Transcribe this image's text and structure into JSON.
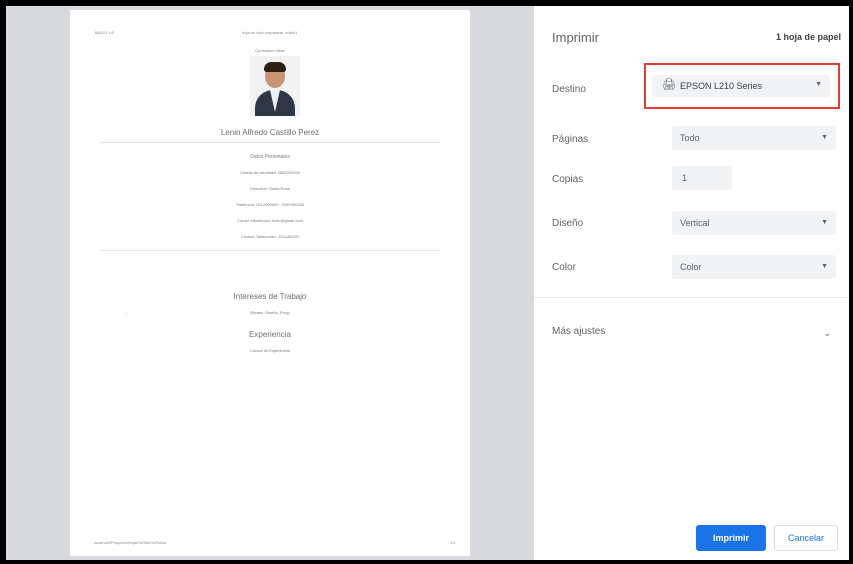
{
  "preview": {
    "header_left": "18/6/21 4:0",
    "header_center": "hoja de vida preparada. ndbm1",
    "curriculum_title": "Curriculum Vitae",
    "name": "Lenin Alfredo Castillo Perez",
    "section_personal": "Datos Personales",
    "personal_lines": [
      "Cédula de identidad: 0850002000",
      "Dirección: Santa Rosa",
      "Teléfono/s: 0212000000 - 0987000000",
      "Correo electrónico: lenin@gmail.com",
      "Ciudad: Tabacundo - ECUADOR"
    ],
    "section_interests": "Intereses de Trabajo",
    "interests_line": "(Redes, Diseño, Prog)",
    "section_experience": "Experiencia",
    "experience_line": "Cursos de Experiencia",
    "footer_left": "localhost/Proyecto/Hojas%20de%20vida",
    "footer_right": "1/1",
    "bullet": "."
  },
  "panel": {
    "title": "Imprimir",
    "sheet_count": "1 hoja de papel",
    "destination_label": "Destino",
    "destination_value": "EPSON L210 Series",
    "pages_label": "Páginas",
    "pages_value": "Todo",
    "copies_label": "Copias",
    "copies_value": "1",
    "layout_label": "Diseño",
    "layout_value": "Vertical",
    "color_label": "Color",
    "color_value": "Color",
    "more_settings_label": "Más ajustes",
    "print_button": "Imprimir",
    "cancel_button": "Cancelar"
  },
  "icons": {
    "printer": "printer-icon",
    "dropdown": "chevron-down-icon"
  },
  "colors": {
    "accent": "#1a73e8",
    "highlight_border": "#e53935",
    "field_bg": "#f1f3f4",
    "preview_bg": "#dadce0"
  }
}
